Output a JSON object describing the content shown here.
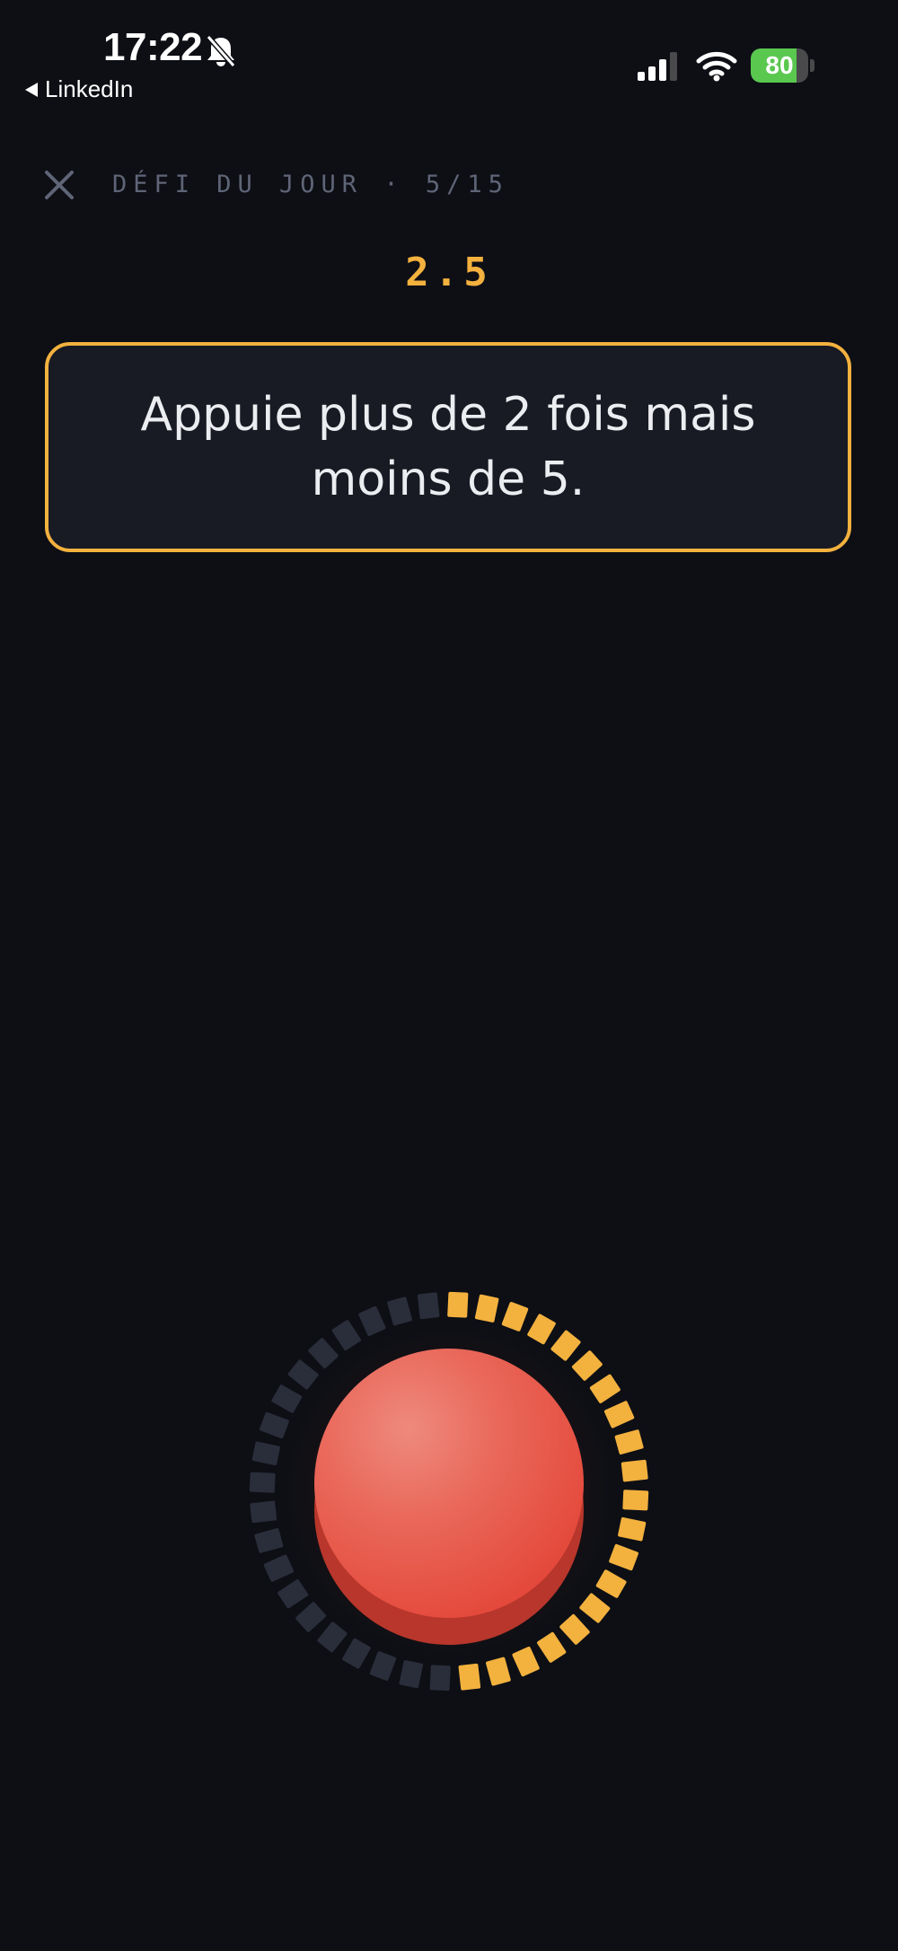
{
  "status_bar": {
    "time": "17:22",
    "back_app": "LinkedIn",
    "battery_percent": "80",
    "battery_level": 0.8,
    "battery_charging": true,
    "silent_mode": true
  },
  "header": {
    "close_icon": "close-icon",
    "challenge_label": "DÉFI DU JOUR · 5/15"
  },
  "score": "2.5",
  "prompt": {
    "text": "Appuie plus de 2 fois mais moins de 5."
  },
  "tap_button": {
    "icon": "red-push-button",
    "timer_progress": 0.5
  },
  "colors": {
    "background": "#0d0f15",
    "accent": "#f3b13e",
    "button": "#e84a3c",
    "dial_inactive": "#2a2d3a",
    "muted_text": "#5f6577"
  }
}
